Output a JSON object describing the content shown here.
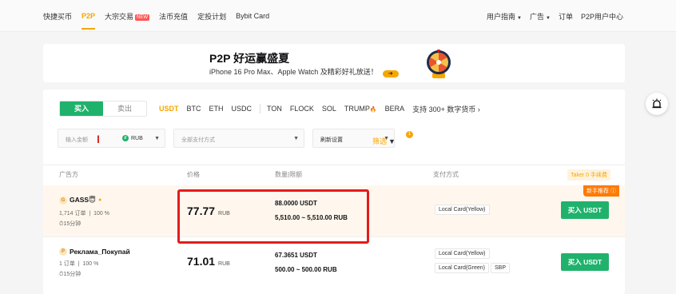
{
  "nav": {
    "left": [
      "快捷买币",
      "P2P",
      "大宗交易",
      "法币充值",
      "定投计划",
      "Bybit Card"
    ],
    "new_badge": "NEW",
    "right": [
      "用户指南",
      "广告",
      "订单",
      "P2P用户中心"
    ]
  },
  "banner": {
    "title": "P2P 好运赢盛夏",
    "subtitle": "iPhone 16 Pro Max、Apple Watch 及精彩好礼放送！"
  },
  "trade": {
    "buy_label": "买入",
    "sell_label": "卖出",
    "coins": [
      "USDT",
      "BTC",
      "ETH",
      "USDC",
      "TON",
      "FLOCK",
      "SOL",
      "TRUMP",
      "BERA"
    ],
    "more_coins": "支持 300+ 数字货币",
    "amount_placeholder": "输入金额",
    "currency": "RUB",
    "payment_placeholder": "全部支付方式",
    "refresh_label": "刷新设置",
    "filter_label": "筛选",
    "filter_count": "1"
  },
  "table": {
    "headers": [
      "广告方",
      "价格",
      "数量|限额",
      "支付方式"
    ],
    "taker_fee": "Taker 0 手续费",
    "buy_button": "买入 USDT",
    "rows": [
      {
        "avatar": "G",
        "name": "GASS😇",
        "orders": "1,714 订单",
        "completion": "100 %",
        "time": "⏱15分钟",
        "price": "77.77",
        "unit": "RUB",
        "quantity": "88.0000 USDT",
        "limit": "5,510.00 ~ 5,510.00 RUB",
        "payments": [
          "Local Card(Yellow)"
        ],
        "badge": "新手推荐 ⓘ"
      },
      {
        "avatar": "P",
        "name": "Реклама_Покупай",
        "orders": "1 订单",
        "completion": "100 %",
        "time": "⏱15分钟",
        "price": "71.01",
        "unit": "RUB",
        "quantity": "67.3651 USDT",
        "limit": "500.00 ~ 500.00 RUB",
        "payments": [
          "Local Card(Yellow)",
          "Local Card(Green)",
          "SBP"
        ]
      }
    ]
  },
  "colors": {
    "accent": "#f7a600",
    "buy": "#20b26c",
    "highlight": "#e41b1b"
  }
}
